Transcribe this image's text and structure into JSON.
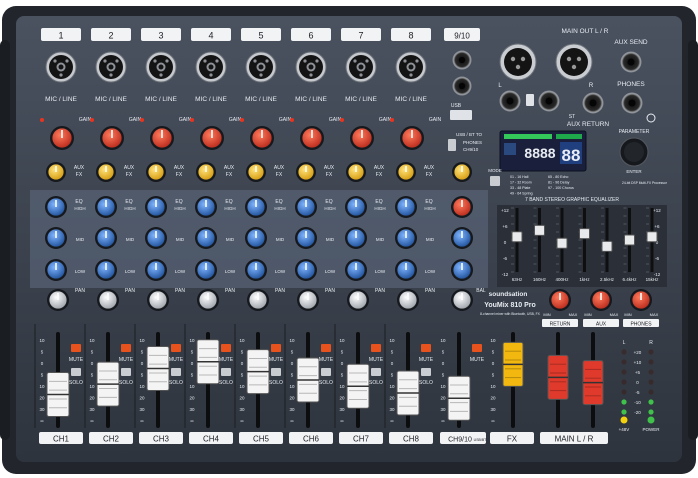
{
  "channels": [
    {
      "number": "1",
      "name": "CH1",
      "input_label": "MIC / LINE",
      "fader": 0.22
    },
    {
      "number": "2",
      "name": "CH2",
      "input_label": "MIC / LINE",
      "fader": 0.42
    },
    {
      "number": "3",
      "name": "CH3",
      "input_label": "MIC / LINE",
      "fader": 0.72
    },
    {
      "number": "4",
      "name": "CH4",
      "input_label": "MIC / LINE",
      "fader": 0.85
    },
    {
      "number": "5",
      "name": "CH5",
      "input_label": "MIC / LINE",
      "fader": 0.66
    },
    {
      "number": "6",
      "name": "CH6",
      "input_label": "MIC / LINE",
      "fader": 0.5
    },
    {
      "number": "7",
      "name": "CH7",
      "input_label": "MIC / LINE",
      "fader": 0.38
    },
    {
      "number": "8",
      "name": "CH8",
      "input_label": "MIC / LINE",
      "fader": 0.25
    }
  ],
  "stereo_channel": {
    "number": "9/10",
    "name": "CH9/10",
    "sub_label": "USB/BT",
    "fader": 0.15
  },
  "fx_strip": {
    "name": "FX",
    "fader": 0.8
  },
  "main_strip": {
    "name": "MAIN L / R",
    "fader_l": 0.55,
    "fader_r": 0.45
  },
  "strip_labels": {
    "mute": "MUTE",
    "solo": "SOLO",
    "pan": "PAN",
    "bal": "BAL",
    "gain": "GAIN",
    "aux": "AUX",
    "fx": "FX",
    "eq": "EQ",
    "hi": "HIGH",
    "mid": "MID",
    "low": "LOW"
  },
  "fader_scale": [
    "10",
    "5",
    "0",
    "5",
    "10",
    "20",
    "30",
    "∞"
  ],
  "header": {
    "main_out_label": "MAIN OUT L / R",
    "aux_send_label": "AUX SEND",
    "phones_label": "PHONES",
    "aux_return_label": "AUX RETURN",
    "usb_label": "USB",
    "usb_bt_label": "USB / BT TO",
    "phones_option": "PHONES",
    "ch_option": "CH9/10",
    "left": "L",
    "right": "R",
    "st": "ST"
  },
  "fx_display": {
    "digits": "8888",
    "preset_digits": "88",
    "parameter_label": "PARAMETER",
    "enter_label": "ENTER",
    "processor_label": "24-bit DSP Multi-FX Processor",
    "mode_label": "MODE"
  },
  "fx_presets": [
    "01 - 16 Hall",
    "17 - 32 Room",
    "33 - 48 Plate",
    "49 - 64 Spring",
    "65 - 80 Echo",
    "81 - 96 Delay",
    "97 - 100 Chorus"
  ],
  "geq": {
    "title": "7 BAND STEREO GRAPHIC EQUALIZER",
    "bands": [
      "63Hz",
      "160Hz",
      "400Hz",
      "1kHz",
      "2.5kHz",
      "6.4kHz",
      "15kHz"
    ],
    "gains": [
      0.1,
      0.3,
      -0.1,
      0.2,
      -0.2,
      0.0,
      0.1
    ],
    "scale": [
      "+12",
      "+6",
      "0",
      "-6",
      "-12"
    ]
  },
  "returns": {
    "return_label": "RETURN",
    "aux_label": "AUX",
    "phones_label": "PHONES",
    "min": "MIN",
    "max": "MAX"
  },
  "brand": {
    "name": "soundsation",
    "model": "YouMix 810 Pro",
    "tagline": "8-channel mixer with Bluetooth, USB, FX"
  },
  "meter": {
    "labels": [
      "+20",
      "+10",
      "+5",
      "0",
      "-5",
      "-10",
      "-20"
    ],
    "l_level": 0.35,
    "r_level": 0.35,
    "power_label": "POWER",
    "phantom_label": "+48V",
    "left": "L",
    "right": "R"
  },
  "colors": {
    "panel": "#3a4250",
    "mute": "#e8531d",
    "red_knob": "#d83a2a",
    "yellow_knob": "#e8b416",
    "blue_knob": "#2f6db8",
    "lcd_bg": "#1a1f3b",
    "lcd_digits": "#4a9cff"
  }
}
